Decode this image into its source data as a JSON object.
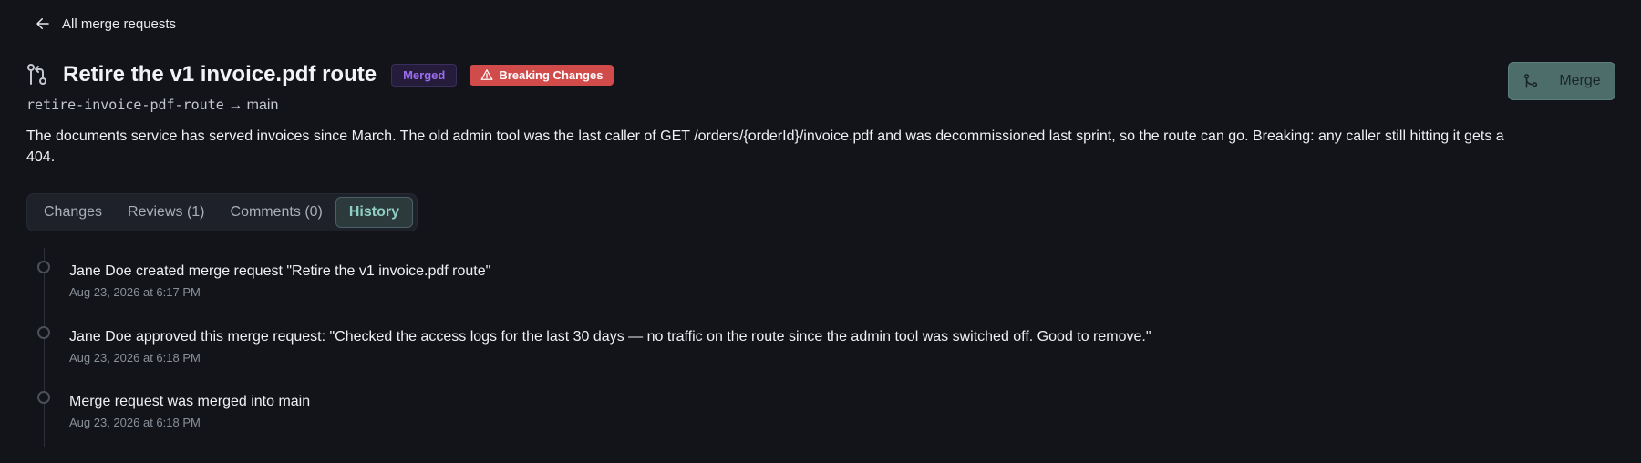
{
  "nav": {
    "back_label": "All merge requests"
  },
  "merge_request": {
    "title": "Retire the v1 invoice.pdf route",
    "status_badge": "Merged",
    "breaking_badge": "Breaking Changes",
    "source_branch": "retire-invoice-pdf-route",
    "target_branch": "main",
    "description": "The documents service has served invoices since March. The old admin tool was the last caller of GET /orders/{orderId}/invoice.pdf and was decommissioned last sprint, so the route can go. Breaking: any caller still hitting it gets a 404."
  },
  "actions": {
    "merge_label": "Merge"
  },
  "tabs": [
    {
      "label": "Changes",
      "active": false
    },
    {
      "label": "Reviews (1)",
      "active": false
    },
    {
      "label": "Comments (0)",
      "active": false
    },
    {
      "label": "History",
      "active": true
    }
  ],
  "history": [
    {
      "text": "Jane Doe created merge request \"Retire the v1 invoice.pdf route\"",
      "time": "Aug 23, 2026 at 6:17 PM"
    },
    {
      "text": "Jane Doe approved this merge request: \"Checked the access logs for the last 30 days — no traffic on the route since the admin tool was switched off. Good to remove.\"",
      "time": "Aug 23, 2026 at 6:18 PM"
    },
    {
      "text": "Merge request was merged into main",
      "time": "Aug 23, 2026 at 6:18 PM"
    }
  ],
  "colors": {
    "background": "#121419",
    "merged_badge": "#9b6cf0",
    "breaking_badge": "#d24b4b",
    "merge_button": "#4d6d6a",
    "active_tab_text": "#8fcfc6"
  },
  "icons": {
    "back": "arrow-left-icon",
    "merge_request": "git-merge-request-icon",
    "warning": "warning-triangle-icon",
    "merge": "git-merge-icon"
  }
}
